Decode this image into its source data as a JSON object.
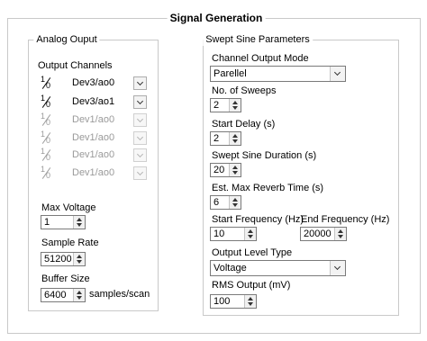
{
  "title": "Signal Generation",
  "analog": {
    "title": "Analog Ouput",
    "channels_label": "Output Channels",
    "channels": [
      {
        "name": "Dev3/ao0",
        "enabled": true
      },
      {
        "name": "Dev3/ao1",
        "enabled": true
      },
      {
        "name": "Dev1/ao0",
        "enabled": false
      },
      {
        "name": "Dev1/ao0",
        "enabled": false
      },
      {
        "name": "Dev1/ao0",
        "enabled": false
      },
      {
        "name": "Dev1/ao0",
        "enabled": false
      }
    ],
    "channel_icon": {
      "name": "io-channel-icon",
      "one": "1",
      "zero": "0"
    },
    "max_voltage": {
      "label": "Max Voltage",
      "value": "1"
    },
    "sample_rate": {
      "label": "Sample Rate",
      "value": "51200"
    },
    "buffer_size": {
      "label": "Buffer Size",
      "value": "6400",
      "unit": "samples/scan"
    }
  },
  "swept": {
    "title": "Swept Sine Parameters",
    "channel_output_mode": {
      "label": "Channel Output Mode",
      "value": "Parellel"
    },
    "num_sweeps": {
      "label": "No. of Sweeps",
      "value": "2"
    },
    "start_delay": {
      "label": "Start Delay (s)",
      "value": "2"
    },
    "duration": {
      "label": "Swept Sine Duration (s)",
      "value": "20"
    },
    "reverb_time": {
      "label": "Est. Max Reverb Time (s)",
      "value": "6"
    },
    "start_freq": {
      "label": "Start Frequency (Hz)",
      "value": "10"
    },
    "end_freq": {
      "label": "End Frequency (Hz)",
      "value": "20000"
    },
    "output_level_type": {
      "label": "Output Level Type",
      "value": "Voltage"
    },
    "rms_output": {
      "label": "RMS Output (mV)",
      "value": "100"
    }
  },
  "colors": {
    "frame_border": "#c9c9c9",
    "disabled_text": "#9a9a9a"
  }
}
